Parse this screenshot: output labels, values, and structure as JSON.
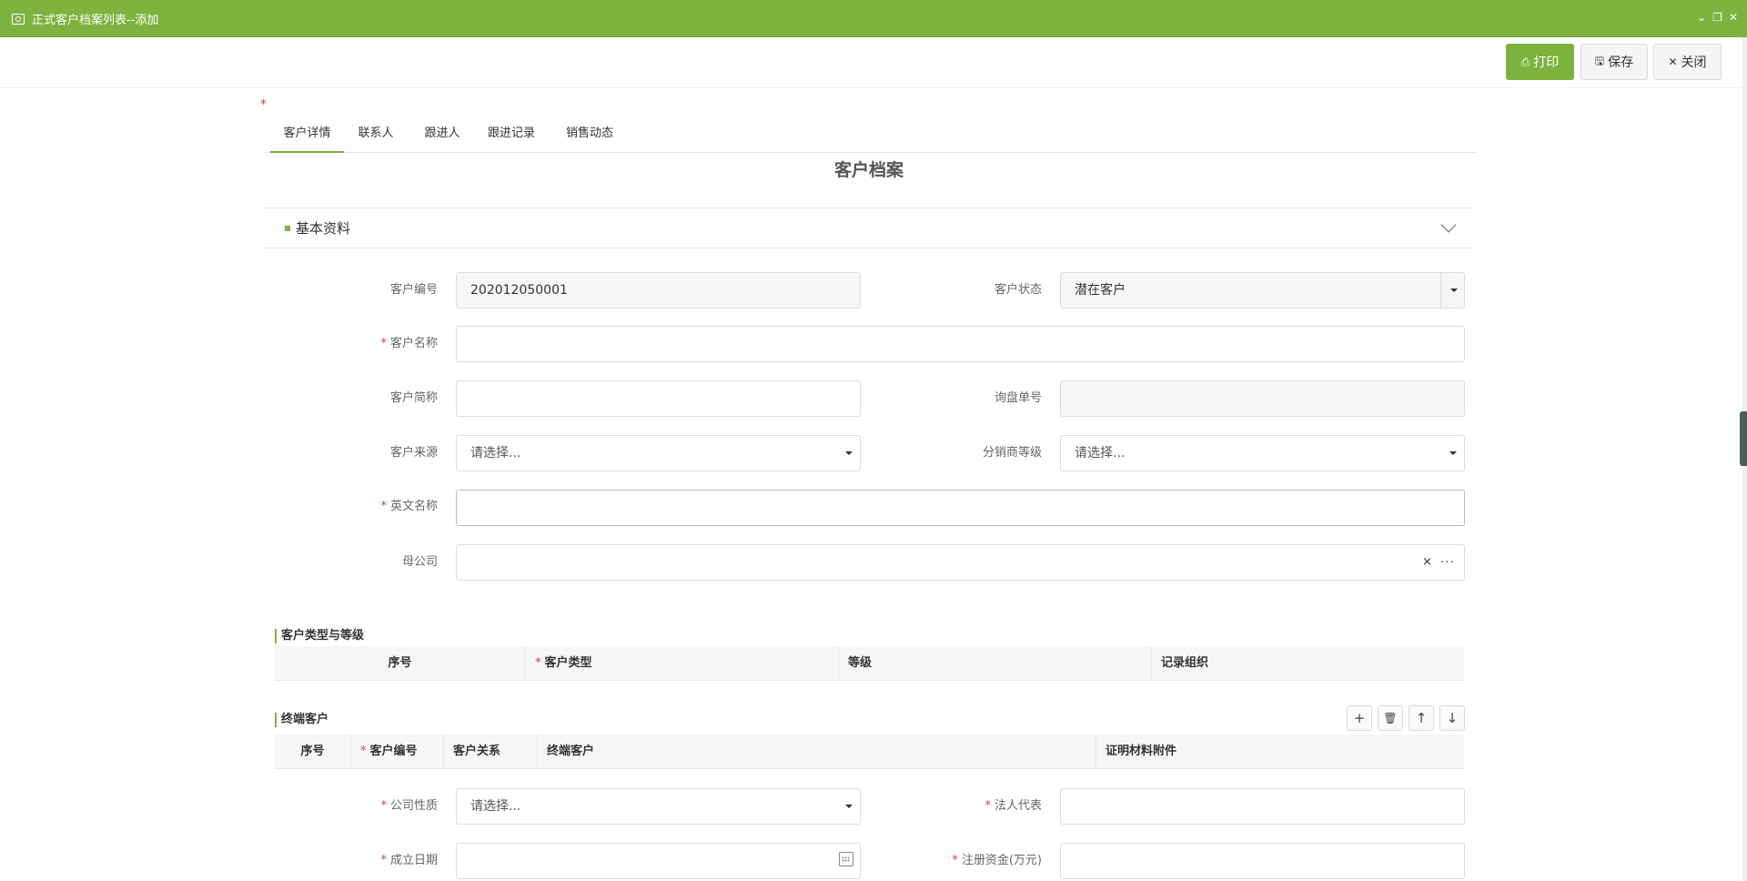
{
  "window": {
    "title": "正式客户档案列表--添加",
    "ctrl_collapse": "⌄",
    "ctrl_restore": "❐",
    "ctrl_close": "✕"
  },
  "toolbar": {
    "print_label": "打印",
    "save_label": "保存",
    "close_label": "关闭"
  },
  "tabs": [
    "客户详情",
    "联系人",
    "跟进人",
    "跟进记录",
    "销售动态"
  ],
  "active_tab": "客户详情",
  "document_title": "客户档案",
  "section": {
    "title": "基本资料"
  },
  "form": {
    "customer_code": {
      "label": "客户编号",
      "value": "202012050001"
    },
    "customer_status": {
      "label": "客户状态",
      "value": "潜在客户"
    },
    "customer_name": {
      "label": "客户名称",
      "value": ""
    },
    "customer_short": {
      "label": "客户简称",
      "value": ""
    },
    "inquiry_no": {
      "label": "询盘单号",
      "value": ""
    },
    "customer_source": {
      "label": "客户来源",
      "placeholder": "请选择..."
    },
    "distributor_level": {
      "label": "分销商等级",
      "placeholder": "请选择..."
    },
    "english_name": {
      "label": "英文名称",
      "value": ""
    },
    "parent_company": {
      "label": "母公司",
      "value": "",
      "clear": "×",
      "more": "···"
    },
    "company_nature": {
      "label": "公司性质",
      "placeholder": "请选择..."
    },
    "legal_rep": {
      "label": "法人代表",
      "value": ""
    },
    "founded_date": {
      "label": "成立日期",
      "value": ""
    },
    "registered_capital": {
      "label": "注册资金(万元)",
      "value": ""
    }
  },
  "type_grade_table": {
    "title": "客户类型与等级",
    "columns": [
      "序号",
      "客户类型",
      "等级",
      "记录组织"
    ]
  },
  "end_customer_table": {
    "title": "终端客户",
    "columns": [
      "序号",
      "客户编号",
      "客户关系",
      "终端客户",
      "证明材料附件"
    ],
    "buttons": {
      "add": "+",
      "delete": "🗑",
      "up": "↑",
      "down": "↓"
    }
  },
  "colors": {
    "accent": "#7db23f",
    "required": "#e53935"
  }
}
